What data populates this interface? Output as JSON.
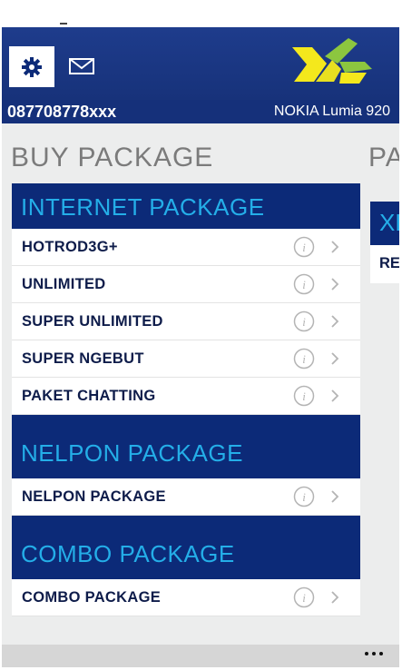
{
  "header": {
    "phone_number": "087708778xxx",
    "device_name": "NOKIA Lumia 920"
  },
  "page": {
    "title": "BUY PACKAGE",
    "next_title": "PA",
    "next_section_head": "XL",
    "next_row_label": "RE"
  },
  "sections": [
    {
      "title": "INTERNET PACKAGE",
      "items": [
        {
          "label": "HOTROD3G+"
        },
        {
          "label": "UNLIMITED"
        },
        {
          "label": "SUPER UNLIMITED"
        },
        {
          "label": "SUPER NGEBUT"
        },
        {
          "label": "PAKET CHATTING"
        }
      ]
    },
    {
      "title": "NELPON PACKAGE",
      "items": [
        {
          "label": "NELPON PACKAGE"
        }
      ]
    },
    {
      "title": "COMBO PACKAGE",
      "items": [
        {
          "label": "COMBO PACKAGE"
        }
      ]
    }
  ],
  "icons": {
    "settings": "gear-icon",
    "mail": "mail-icon",
    "info": "info-icon",
    "chevron": "chevron-right-icon",
    "more": "more-dots-icon"
  },
  "colors": {
    "header_blue": "#1e3c8c",
    "section_navy": "#0c2a78",
    "section_text_cyan": "#24aee8",
    "brand_green": "#8cc63f",
    "brand_yellow": "#f4e81c"
  }
}
